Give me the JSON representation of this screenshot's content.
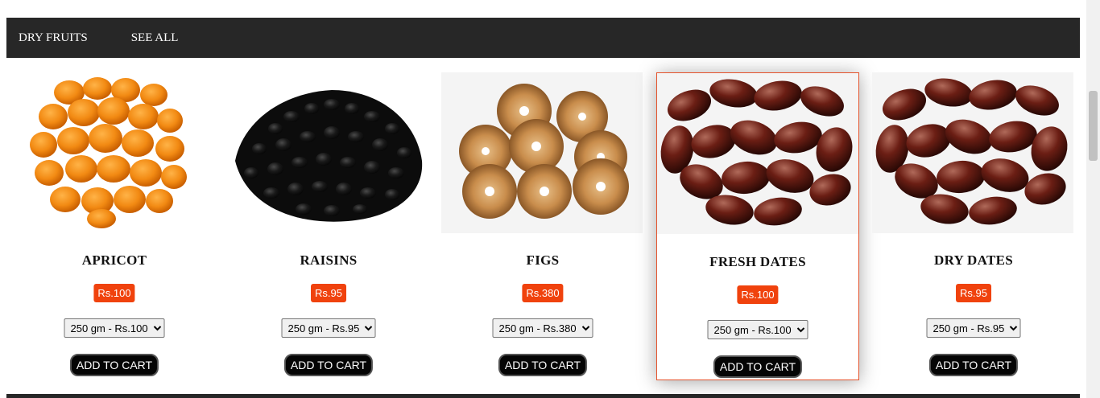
{
  "nav": {
    "category_label": "DRY FRUITS",
    "see_all_label": "SEE ALL"
  },
  "products": [
    {
      "name": "APRICOT",
      "price": "Rs.100",
      "size_selected": "250 gm - Rs.100",
      "cart_label": "ADD TO CART",
      "image_icon": "apricot-image"
    },
    {
      "name": "RAISINS",
      "price": "Rs.95",
      "size_selected": "250 gm - Rs.95",
      "cart_label": "ADD TO CART",
      "image_icon": "raisins-image"
    },
    {
      "name": "FIGS",
      "price": "Rs.380",
      "size_selected": "250 gm - Rs.380",
      "cart_label": "ADD TO CART",
      "image_icon": "figs-image"
    },
    {
      "name": "FRESH DATES",
      "price": "Rs.100",
      "size_selected": "250 gm - Rs.100",
      "cart_label": "ADD TO CART",
      "image_icon": "dates-image",
      "featured": true
    },
    {
      "name": "DRY DATES",
      "price": "Rs.95",
      "size_selected": "250 gm - Rs.95",
      "cart_label": "ADD TO CART",
      "image_icon": "dates-image"
    }
  ],
  "colors": {
    "nav_bg": "#272727",
    "price_badge": "#f0420d",
    "featured_border": "#e5532c",
    "cart_button": "#050505"
  }
}
